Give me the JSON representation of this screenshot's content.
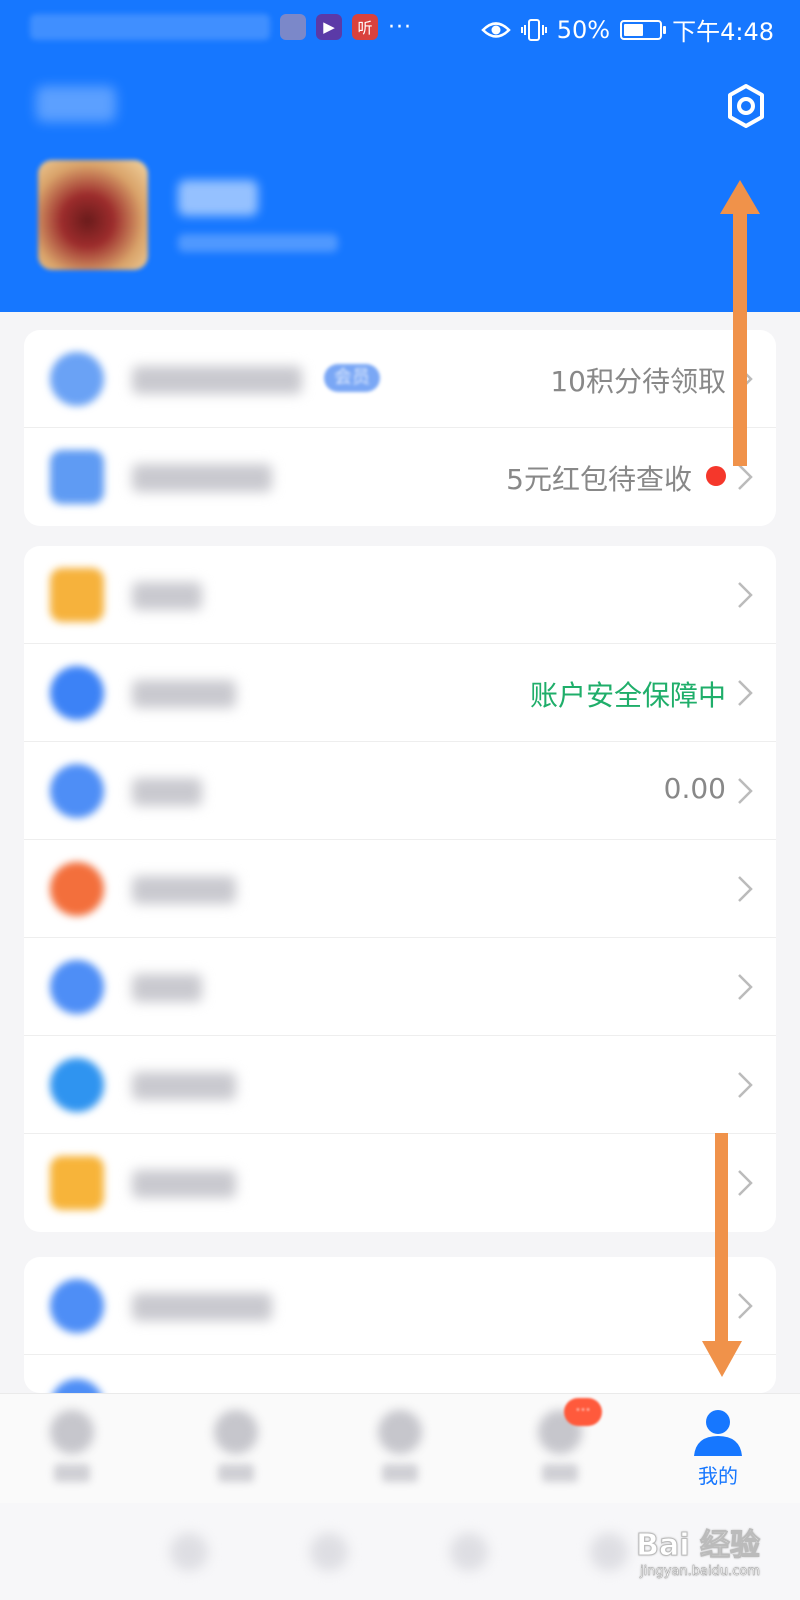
{
  "status_bar": {
    "app_icons": [
      "▶",
      "听"
    ],
    "more": "···",
    "battery": "50%",
    "time": "下午4:48"
  },
  "header": {
    "settings_icon": "gear-icon"
  },
  "cards": [
    {
      "rows": [
        {
          "icon_color": "#6aa2f5",
          "icon_shape": "circle",
          "right_text": "10积分待领取",
          "has_tag": true,
          "tag_text": "会员"
        },
        {
          "icon_color": "#5f9bf3",
          "icon_shape": "square",
          "right_text": "5元红包待查收",
          "red_dot": true
        }
      ]
    },
    {
      "rows": [
        {
          "icon_color": "#f6b23c",
          "icon_shape": "square",
          "right_text": ""
        },
        {
          "icon_color": "#3c82f6",
          "icon_shape": "circle",
          "right_text": "账户安全保障中",
          "green": true
        },
        {
          "icon_color": "#4e8ef6",
          "icon_shape": "circle",
          "right_text": "0.00"
        },
        {
          "icon_color": "#f36f3c",
          "icon_shape": "circle",
          "right_text": ""
        },
        {
          "icon_color": "#4e8ef6",
          "icon_shape": "circle",
          "right_text": ""
        },
        {
          "icon_color": "#2f94f0",
          "icon_shape": "circle",
          "right_text": ""
        },
        {
          "icon_color": "#f7b43a",
          "icon_shape": "square",
          "right_text": ""
        }
      ]
    },
    {
      "rows": [
        {
          "icon_color": "#4e8ef6",
          "icon_shape": "circle",
          "right_text": ""
        }
      ]
    }
  ],
  "tabbar": {
    "active_tab_label": "我的",
    "message_badge": "···"
  },
  "watermark": {
    "brand": "Bai 经验",
    "url": "jingyan.baidu.com"
  },
  "colors": {
    "brand_blue": "#1677ff",
    "annotation_arrow": "#f0924a"
  }
}
